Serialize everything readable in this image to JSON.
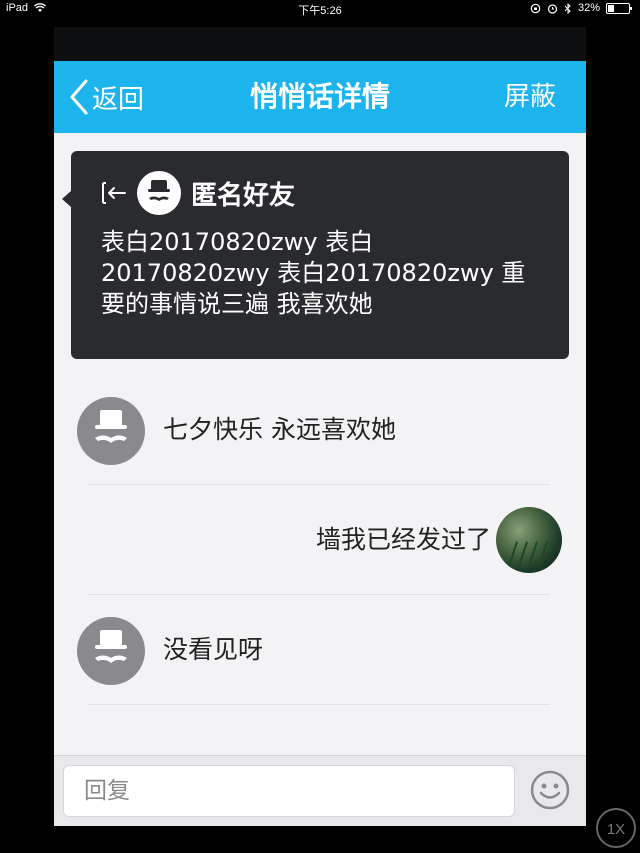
{
  "status_bar": {
    "device": "iPad",
    "time": "下午5:26",
    "battery": "32%",
    "battery_level": 0.32
  },
  "navbar": {
    "back_label": "返回",
    "title": "悄悄话详情",
    "block_label": "屏蔽",
    "bg_color": "#1db3ec"
  },
  "main_card": {
    "sender_name": "匿名好友",
    "content": "表白20170820zwy 表白20170820zwy 表白20170820zwy 重要的事情说三遍 我喜欢她"
  },
  "messages": [
    {
      "side": "left",
      "avatar": "anonymous-avatar",
      "text": "七夕快乐 永远喜欢她"
    },
    {
      "side": "right",
      "avatar": "user-avatar",
      "text": "墙我已经发过了"
    },
    {
      "side": "left",
      "avatar": "anonymous-avatar",
      "text": "没看见呀"
    }
  ],
  "input_bar": {
    "placeholder": "回复",
    "emoji_icon": "smiley-icon"
  },
  "zoom_badge": "1X"
}
